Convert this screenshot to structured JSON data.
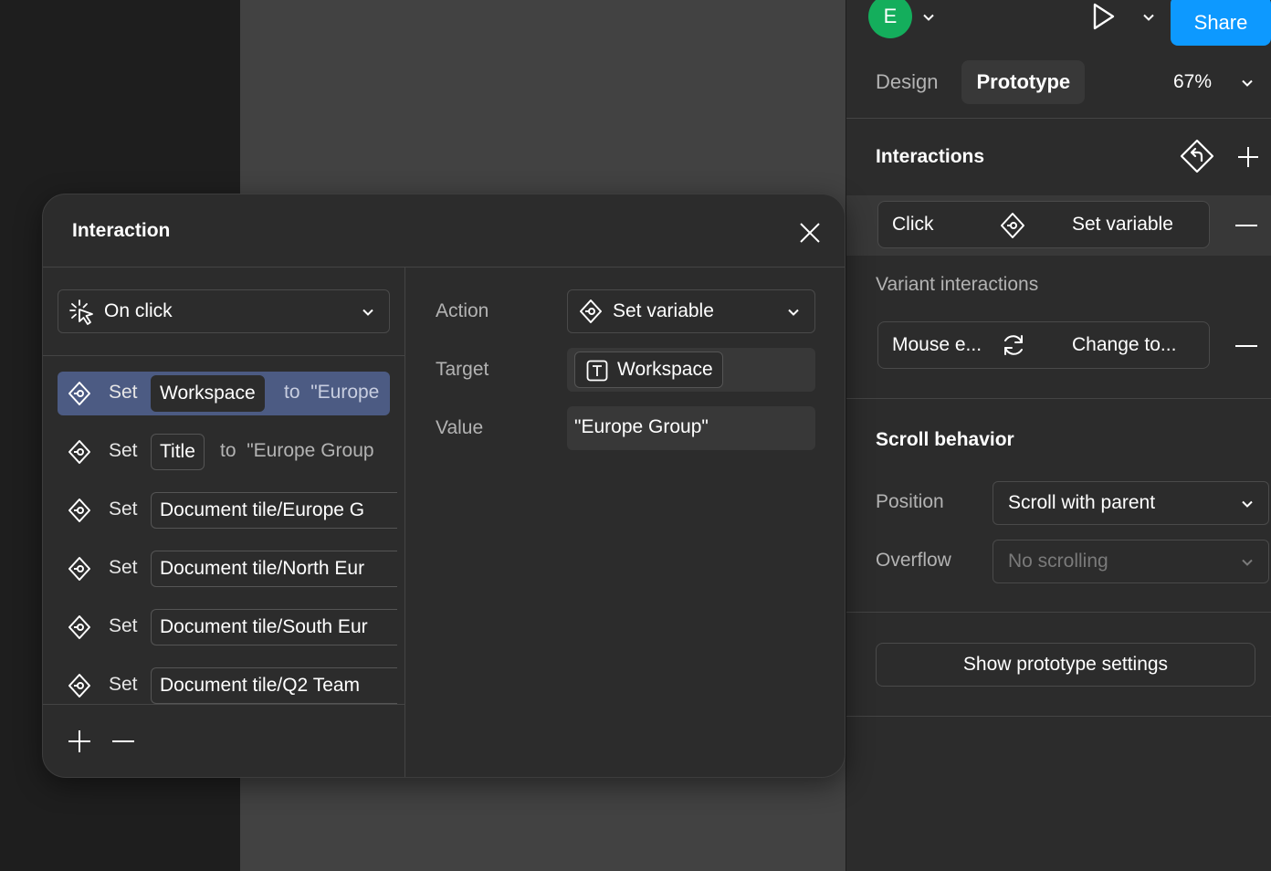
{
  "header": {
    "avatar_initial": "E",
    "share_label": "Share",
    "tabs": [
      {
        "label": "Design",
        "active": false
      },
      {
        "label": "Prototype",
        "active": true
      }
    ],
    "zoom": "67%"
  },
  "interactions_panel": {
    "title": "Interactions",
    "interaction": {
      "trigger": "Click",
      "action": "Set variable"
    },
    "variant_title": "Variant interactions",
    "variant": {
      "trigger": "Mouse e...",
      "action": "Change to..."
    }
  },
  "scroll_behavior": {
    "title": "Scroll behavior",
    "position_label": "Position",
    "position_value": "Scroll with parent",
    "overflow_label": "Overflow",
    "overflow_value": "No scrolling"
  },
  "settings_button": "Show prototype settings",
  "modal": {
    "title": "Interaction",
    "trigger": "On click",
    "actions": [
      {
        "verb": "Set",
        "variable": "Workspace",
        "to": "to",
        "value": "\"Europe",
        "selected": true
      },
      {
        "verb": "Set",
        "variable": "Title",
        "to": "to",
        "value": "\"Europe Group",
        "selected": false
      },
      {
        "verb": "Set",
        "variable": "Document tile/Europe G",
        "to": "",
        "value": "",
        "selected": false
      },
      {
        "verb": "Set",
        "variable": "Document tile/North Eur",
        "to": "",
        "value": "",
        "selected": false
      },
      {
        "verb": "Set",
        "variable": "Document tile/South Eur",
        "to": "",
        "value": "",
        "selected": false
      },
      {
        "verb": "Set",
        "variable": "Document tile/Q2 Team",
        "to": "",
        "value": "",
        "selected": false
      }
    ],
    "fields": {
      "action_label": "Action",
      "action_value": "Set variable",
      "target_label": "Target",
      "target_value": "Workspace",
      "value_label": "Value",
      "value_value": "\"Europe Group\""
    }
  },
  "colors": {
    "accent": "#0d99ff",
    "avatar": "#14ae5c",
    "selection": "#4c5b83",
    "panel": "#2c2c2c",
    "canvas": "#424242"
  }
}
